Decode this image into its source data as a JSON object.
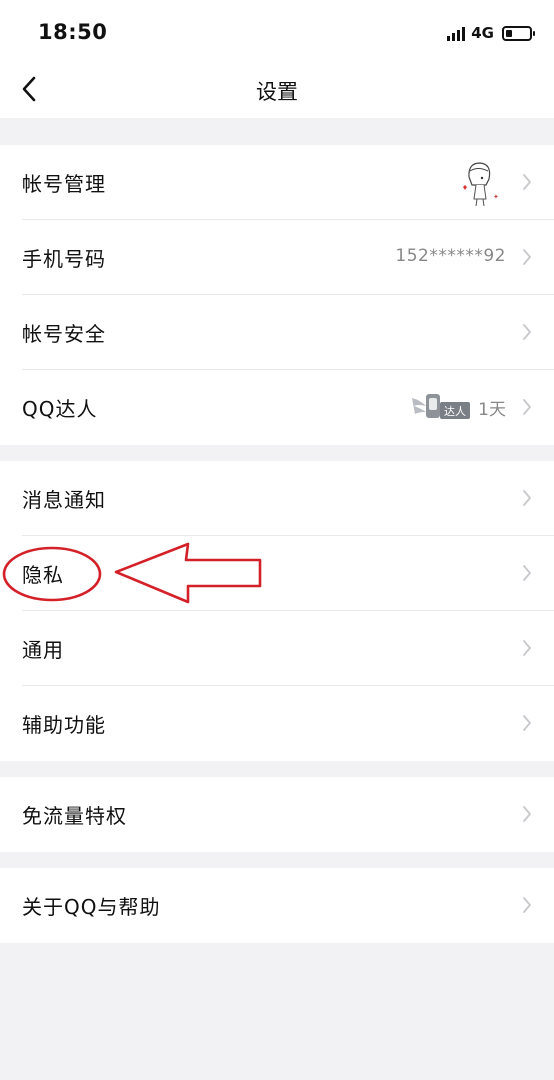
{
  "status_bar": {
    "time": "18:50",
    "network": "4G"
  },
  "nav": {
    "title": "设置"
  },
  "groups": [
    {
      "items": [
        {
          "label": "帐号管理"
        },
        {
          "label": "手机号码",
          "value": "152******92"
        },
        {
          "label": "帐号安全"
        },
        {
          "label": "QQ达人",
          "badge_text": "达人",
          "value": "1天"
        }
      ]
    },
    {
      "items": [
        {
          "label": "消息通知"
        },
        {
          "label": "隐私"
        },
        {
          "label": "通用"
        },
        {
          "label": "辅助功能"
        }
      ]
    },
    {
      "items": [
        {
          "label": "免流量特权"
        }
      ]
    },
    {
      "items": [
        {
          "label": "关于QQ与帮助"
        }
      ]
    }
  ],
  "colors": {
    "annotation": "#d42028",
    "chevron": "#c7c7cc",
    "value_text": "#888888"
  }
}
